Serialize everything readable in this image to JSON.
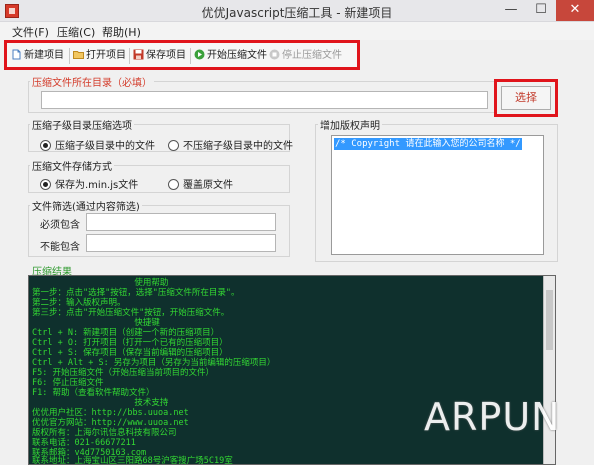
{
  "window": {
    "title": "优优Javascript压缩工具 - 新建项目",
    "min_glyph": "—",
    "max_glyph": "☐",
    "close_glyph": "✕"
  },
  "menu": [
    "文件(F)",
    "压缩(C)",
    "帮助(H)"
  ],
  "toolbar": {
    "items": [
      {
        "label": "新建项目",
        "icon": "new-file-icon",
        "color": "#4a7fc1"
      },
      {
        "label": "打开项目",
        "icon": "open-folder-icon",
        "color": "#e0a73c"
      },
      {
        "label": "保存项目",
        "icon": "save-disk-icon",
        "color": "#c23a2a"
      },
      {
        "label": "开始压缩文件",
        "icon": "play-icon",
        "color": "#3aa03a"
      },
      {
        "label": "停止压缩文件",
        "icon": "stop-icon",
        "color": "#a0a0a0"
      }
    ]
  },
  "directory": {
    "legend": "压缩文件所在目录（必填）",
    "value": "",
    "select_label": "选择"
  },
  "subdir": {
    "legend": "压缩子级目录压缩选项",
    "opt1": "压缩子级目录中的文件",
    "opt2": "不压缩子级目录中的文件",
    "selected": 1
  },
  "storage": {
    "legend": "压缩文件存储方式",
    "opt1": "保存为.min.js文件",
    "opt2": "覆盖原文件",
    "selected": 1
  },
  "filter": {
    "legend": "文件筛选(通过内容筛选)",
    "must_label": "必须包含",
    "must_value": "",
    "not_label": "不能包含",
    "not_value": ""
  },
  "copyright": {
    "legend": "增加版权声明",
    "text": "/* Copyright 请在此输入您的公司名称 */"
  },
  "result": {
    "legend": "压缩结果",
    "lines": [
      "                    使用帮助",
      "第一步：点击\"选择\"按钮，选择\"压缩文件所在目录\"。",
      "第二步：输入版权声明。",
      "第三步：点击\"开始压缩文件\"按钮，开始压缩文件。",
      "                    快捷键",
      "Ctrl + N: 新建项目（创建一个新的压缩项目）",
      "Ctrl + O: 打开项目（打开一个已有的压缩项目）",
      "Ctrl + S: 保存项目（保存当前编辑的压缩项目）",
      "Ctrl + Alt + S: 另存为项目（另存为当前编辑的压缩项目）",
      "F5: 开始压缩文件（开始压缩当前项目的文件）",
      "F6: 停止压缩文件",
      "F1: 帮助（查看软件帮助文件）",
      "                    技术支持",
      "优优用户社区：http://bbs.uuoa.net",
      "优优官方网站：http://www.uuoa.net",
      "版权所有：上海尔讯信息科技有限公司",
      "联系电话：021-66677211",
      "联系邮箱：v4d7750163.com",
      "联系地址：上海宝山区三阳路68号沪客搜广场5C19室"
    ]
  },
  "watermark": "ARPUN"
}
